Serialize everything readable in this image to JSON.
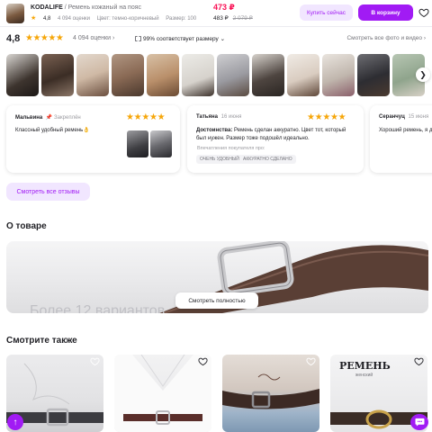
{
  "header": {
    "brand": "KODALIFE",
    "separator": "/",
    "product_name": "Ремень кожаный на пояс",
    "rating": "4,8",
    "ratings_count": "4 094 оценки",
    "color": "Цвет: темно-коричневый",
    "size": "Размер: 100",
    "price": "473 ₽",
    "price_wallet": "483 ₽",
    "price_old": "2 079 ₽",
    "buy_now_label": "Купить сейчас",
    "add_to_cart_label": "В корзину"
  },
  "rating_row": {
    "rating": "4,8",
    "stars": "★★★★★",
    "count": "4 094 оценки ›",
    "size_match": "99% соответствует размеру ⌄",
    "all_media": "Смотреть все фото и видео ›"
  },
  "photo_colors": [
    "#3d342e",
    "#6f5646",
    "#cfb9a5",
    "#8a6a55",
    "#b98f6a",
    "#d6d2cc",
    "#9a9aa0",
    "#4e4540",
    "#d9ccc0",
    "#c0b6ad",
    "#2d2d32",
    "#8fa48c"
  ],
  "reviews": [
    {
      "name": "Мальвина",
      "meta": "📌 Закреплён",
      "stars": "★★★★★",
      "text": "Классный удобный ремень👌"
    },
    {
      "name": "Татьяна",
      "meta": "16 июня",
      "stars": "★★★★★",
      "label": "Достоинства:",
      "text": "Ремень сделан аккуратно. Цвет тот, который был нужен. Размер тоже подошёл идеально.",
      "impressions": "Впечатления покупателя про:",
      "tags": [
        "ОЧЕНЬ УДОБНЫЙ",
        "АККУРАТНО СДЕЛАНО"
      ]
    },
    {
      "name": "Серанчуц",
      "meta": "15 июня",
      "text": "Хороший ремень, я д"
    }
  ],
  "all_reviews_label": "Смотреть все отзывы",
  "about": {
    "title": "О товаре",
    "banner_text": "Более 12 вариантов",
    "show_full_label": "Смотреть полностью"
  },
  "see_also": {
    "title": "Смотрите также",
    "card3_title": "РЕМЕНЬ",
    "card3_sub": "женский"
  },
  "colors": {
    "accent": "#a11bf4",
    "accent_light": "#f1e6ff",
    "price": "#f91155",
    "star": "#f6a609"
  }
}
